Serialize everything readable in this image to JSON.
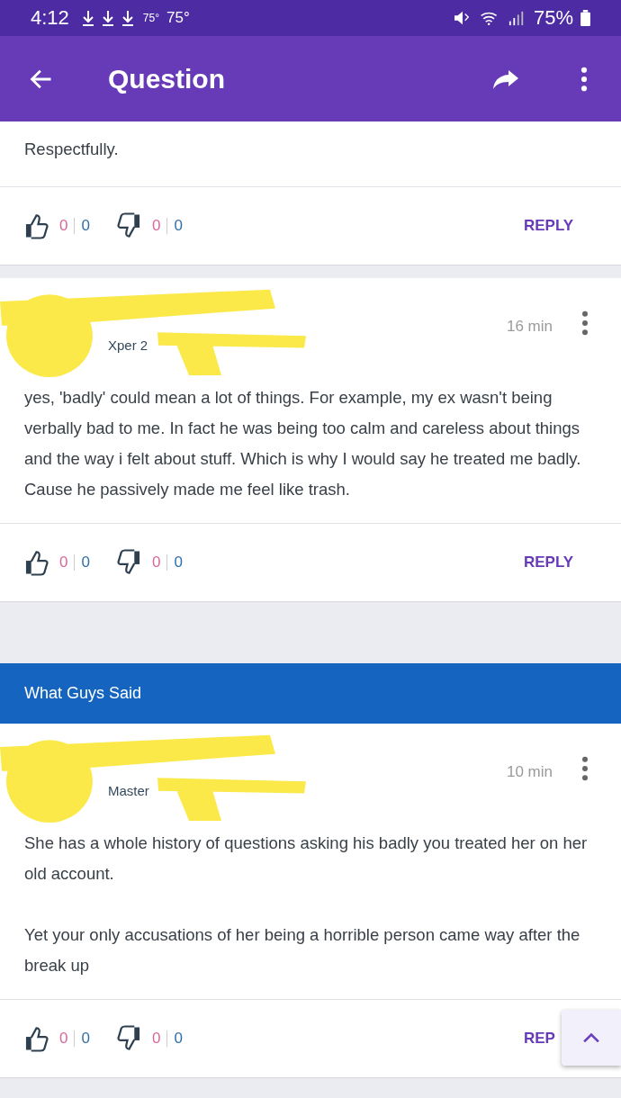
{
  "status_bar": {
    "time": "4:12",
    "weather_small": "75°",
    "weather": "75°",
    "battery": "75%"
  },
  "header": {
    "title": "Question"
  },
  "blocks": [
    {
      "kind": "comment",
      "paragraphs": [
        "Respectfully."
      ],
      "likes": [
        "0",
        "0"
      ],
      "dislikes": [
        "0",
        "0"
      ],
      "reply": "REPLY"
    },
    {
      "kind": "comment",
      "author": {
        "rank": "Xper 2",
        "time": "16 min"
      },
      "paragraphs": [
        "yes, 'badly' could mean a lot of things. For example, my ex wasn't being verbally bad to me. In fact he was being too calm and careless about things and the way i felt about stuff. Which is why I would say he treated me badly. Cause he passively made me feel like trash."
      ],
      "likes": [
        "0",
        "0"
      ],
      "dislikes": [
        "0",
        "0"
      ],
      "reply": "REPLY"
    },
    {
      "kind": "section",
      "title": "What Guys Said"
    },
    {
      "kind": "comment",
      "author": {
        "rank": "Master",
        "time": "10 min"
      },
      "paragraphs": [
        "She has a whole history of questions asking his badly you treated her on her old account.",
        "Yet your only accusations of her being a horrible person came way after the break up"
      ],
      "likes": [
        "0",
        "0"
      ],
      "dislikes": [
        "0",
        "0"
      ],
      "reply": "REP"
    }
  ]
}
